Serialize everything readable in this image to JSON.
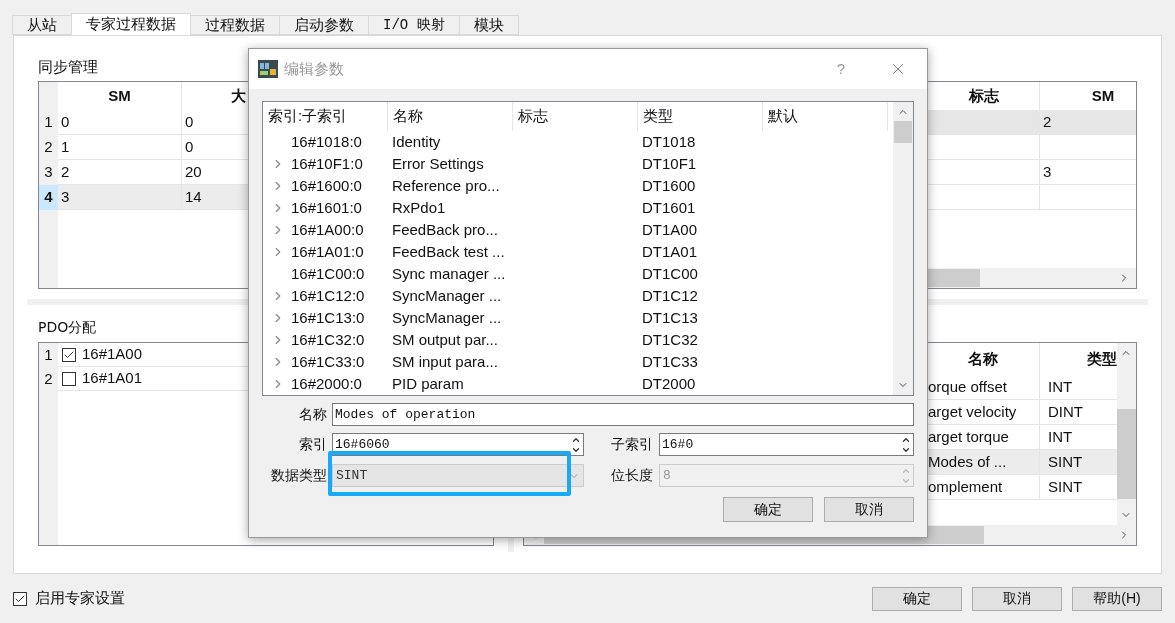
{
  "tabs": [
    {
      "label": "从站",
      "selected": false,
      "mono": false
    },
    {
      "label": "专家过程数据",
      "selected": true,
      "mono": false
    },
    {
      "label": "过程数据",
      "selected": false,
      "mono": false
    },
    {
      "label": "启动参数",
      "selected": false,
      "mono": false
    },
    {
      "label": "I/O 映射",
      "selected": false,
      "mono": true
    },
    {
      "label": "模块",
      "selected": false,
      "mono": false
    }
  ],
  "sync_manager": {
    "title": "同步管理",
    "columns": [
      "SM",
      "大"
    ],
    "right_columns": [
      "标志",
      "SM"
    ],
    "rows": [
      {
        "number": "1",
        "sm": "0",
        "size": "0",
        "selected": false,
        "right_highlighted": true,
        "right_sm": "2"
      },
      {
        "number": "2",
        "sm": "1",
        "size": "0",
        "selected": false,
        "right_highlighted": false
      },
      {
        "number": "3",
        "sm": "2",
        "size": "20",
        "selected": false,
        "right_highlighted": false,
        "right_sm": "3"
      },
      {
        "number": "4",
        "sm": "3",
        "size": "14",
        "selected": true,
        "right_highlighted": false
      }
    ]
  },
  "pdo_assignment": {
    "title": "PDO分配",
    "rows": [
      {
        "number": "1",
        "label": "16#1A00",
        "checked": true
      },
      {
        "number": "2",
        "label": "16#1A01",
        "checked": false
      }
    ]
  },
  "pdo_content": {
    "columns": [
      "名称",
      "类型"
    ],
    "rows": [
      {
        "name": "orque offset",
        "type": "INT",
        "highlighted": false
      },
      {
        "name": "arget velocity",
        "type": "DINT",
        "highlighted": false
      },
      {
        "name": "arget torque",
        "type": "INT",
        "highlighted": false
      },
      {
        "name": "Modes of ...",
        "type": "SINT",
        "highlighted": true
      },
      {
        "name": "omplement",
        "type": "SINT",
        "highlighted": false
      }
    ]
  },
  "dialog": {
    "title": "编辑参数",
    "help": "?",
    "columns": [
      "索引:子索引",
      "名称",
      "标志",
      "类型",
      "默认"
    ],
    "rows": [
      {
        "index": "16#1018:0",
        "name": "Identity",
        "type": "DT1018",
        "expandable": false
      },
      {
        "index": "16#10F1:0",
        "name": "Error Settings",
        "type": "DT10F1",
        "expandable": true
      },
      {
        "index": "16#1600:0",
        "name": "Reference pro...",
        "type": "DT1600",
        "expandable": true
      },
      {
        "index": "16#1601:0",
        "name": "RxPdo1",
        "type": "DT1601",
        "expandable": true
      },
      {
        "index": "16#1A00:0",
        "name": "FeedBack pro...",
        "type": "DT1A00",
        "expandable": true
      },
      {
        "index": "16#1A01:0",
        "name": "FeedBack test ...",
        "type": "DT1A01",
        "expandable": true
      },
      {
        "index": "16#1C00:0",
        "name": "Sync manager ...",
        "type": "DT1C00",
        "expandable": false
      },
      {
        "index": "16#1C12:0",
        "name": "SyncManager ...",
        "type": "DT1C12",
        "expandable": true
      },
      {
        "index": "16#1C13:0",
        "name": "SyncManager ...",
        "type": "DT1C13",
        "expandable": true
      },
      {
        "index": "16#1C32:0",
        "name": "SM output par...",
        "type": "DT1C32",
        "expandable": true
      },
      {
        "index": "16#1C33:0",
        "name": "SM input para...",
        "type": "DT1C33",
        "expandable": true
      },
      {
        "index": "16#2000:0",
        "name": "PID param",
        "type": "DT2000",
        "expandable": true
      }
    ],
    "name_label": "名称",
    "name_value": "Modes of operation",
    "index_label": "索引",
    "index_value": "16#6060",
    "subindex_label": "子索引",
    "subindex_value": "16#0",
    "datatype_label": "数据类型",
    "datatype_value": "SINT",
    "datatype_disabled": true,
    "bitlength_label": "位长度",
    "bitlength_value": "8",
    "bitlength_disabled": true,
    "buttons": [
      "确定",
      "取消"
    ]
  },
  "expert_settings": {
    "label": "启用专家设置",
    "checked": true
  },
  "buttons": [
    "确定",
    "取消",
    "帮助(H)"
  ]
}
